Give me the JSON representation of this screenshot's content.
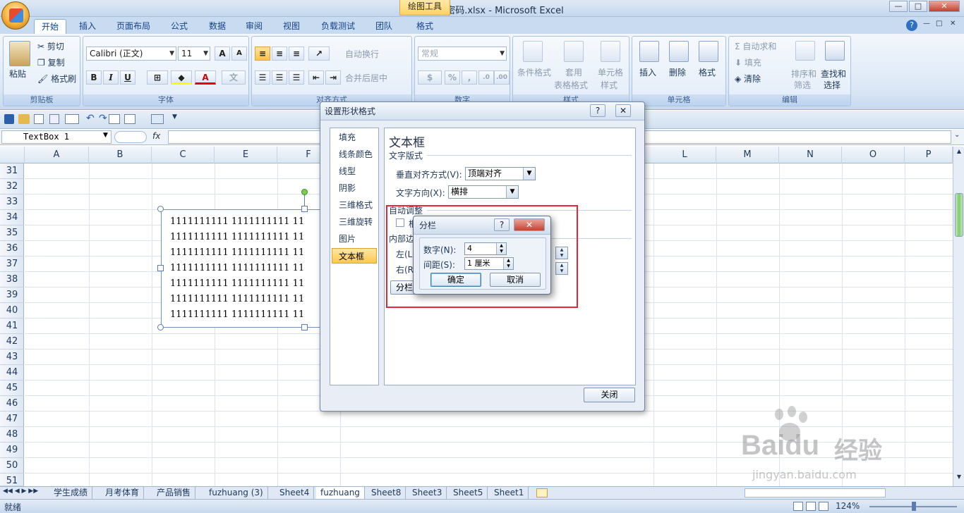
{
  "window": {
    "title": "两小无猜网密码.xlsx - Microsoft Excel",
    "context_tab": "绘图工具",
    "controls": [
      "—",
      "□",
      "✕"
    ],
    "ribbon_controls": [
      "?",
      "—",
      "□",
      "✕"
    ]
  },
  "tabs": [
    "开始",
    "插入",
    "页面布局",
    "公式",
    "数据",
    "审阅",
    "视图",
    "负载测试",
    "团队",
    "格式"
  ],
  "active_tab": "开始",
  "ribbon": {
    "clipboard": {
      "label": "剪贴板",
      "paste": "粘贴",
      "cut": "剪切",
      "copy": "复制",
      "format_painter": "格式刷"
    },
    "font": {
      "label": "字体",
      "name": "Calibri (正文)",
      "size": "11",
      "grow": "A",
      "shrink": "A",
      "bold": "B",
      "italic": "I",
      "underline": "U"
    },
    "alignment": {
      "label": "对齐方式",
      "wrap": "自动换行",
      "merge": "合并后居中"
    },
    "number": {
      "label": "数字",
      "format": "常规",
      "percent": "%",
      "comma": ","
    },
    "styles": {
      "label": "样式",
      "conditional": "条件格式",
      "table_line1": "套用",
      "table_line2": "表格格式",
      "cell_line1": "单元格",
      "cell_line2": "样式"
    },
    "cells": {
      "label": "单元格",
      "insert": "插入",
      "delete": "删除",
      "format": "格式"
    },
    "editing": {
      "label": "编辑",
      "autosum": "自动求和",
      "fill": "填充",
      "clear": "清除",
      "sort_line1": "排序和",
      "sort_line2": "筛选",
      "find_line1": "查找和",
      "find_line2": "选择"
    }
  },
  "formula_bar": {
    "name_box": "TextBox 1",
    "fx": "fx",
    "value": ""
  },
  "columns": [
    "A",
    "B",
    "C",
    "E",
    "F",
    "L",
    "M",
    "N",
    "O",
    "P"
  ],
  "rows": [
    "31",
    "32",
    "33",
    "34",
    "35",
    "36",
    "37",
    "38",
    "39",
    "40",
    "41",
    "42",
    "43",
    "44",
    "45",
    "46",
    "47",
    "48",
    "49",
    "50",
    "51"
  ],
  "textbox_lines": [
    "1111111111 1111111111 11",
    "1111111111 1111111111 11",
    "1111111111 1111111111 11",
    "1111111111 1111111111 11",
    "1111111111 1111111111 11",
    "1111111111 1111111111 11",
    "1111111111 1111111111 11"
  ],
  "sheet_tabs": [
    "学生成绩",
    "月考体育",
    "产品销售",
    "fuzhuang (3)",
    "Sheet4",
    "fuzhuang",
    "Sheet8",
    "Sheet3",
    "Sheet5",
    "Sheet1"
  ],
  "active_sheet": "fuzhuang",
  "status": {
    "ready": "就绪",
    "zoom": "124%"
  },
  "format_dialog": {
    "title": "设置形状格式",
    "help": "?",
    "close_x": "✕",
    "nav": [
      "填充",
      "线条颜色",
      "线型",
      "阴影",
      "三维格式",
      "三维旋转",
      "图片",
      "文本框"
    ],
    "selected": "文本框",
    "panel_title": "文本框",
    "text_layout": "文字版式",
    "valign_label": "垂直对齐方式(V):",
    "valign_value": "顶端对齐",
    "direction_label": "文字方向(X):",
    "direction_value": "横排",
    "autofit": "自动调整",
    "autofit_checkbox_label": "根",
    "inner_margin": "内部边",
    "left_label": "左(L",
    "right_label": "右(R",
    "columns_button": "分栏",
    "close_button": "关闭"
  },
  "columns_dialog": {
    "title": "分栏",
    "help": "?",
    "close_x": "✕",
    "number_label": "数字(N):",
    "number_value": "4",
    "spacing_label": "间距(S):",
    "spacing_value": "1 厘米",
    "ok": "确定",
    "cancel": "取消"
  },
  "watermark": {
    "brand": "Baidu",
    "brand_cn": "经验",
    "url": "jingyan.baidu.com"
  }
}
